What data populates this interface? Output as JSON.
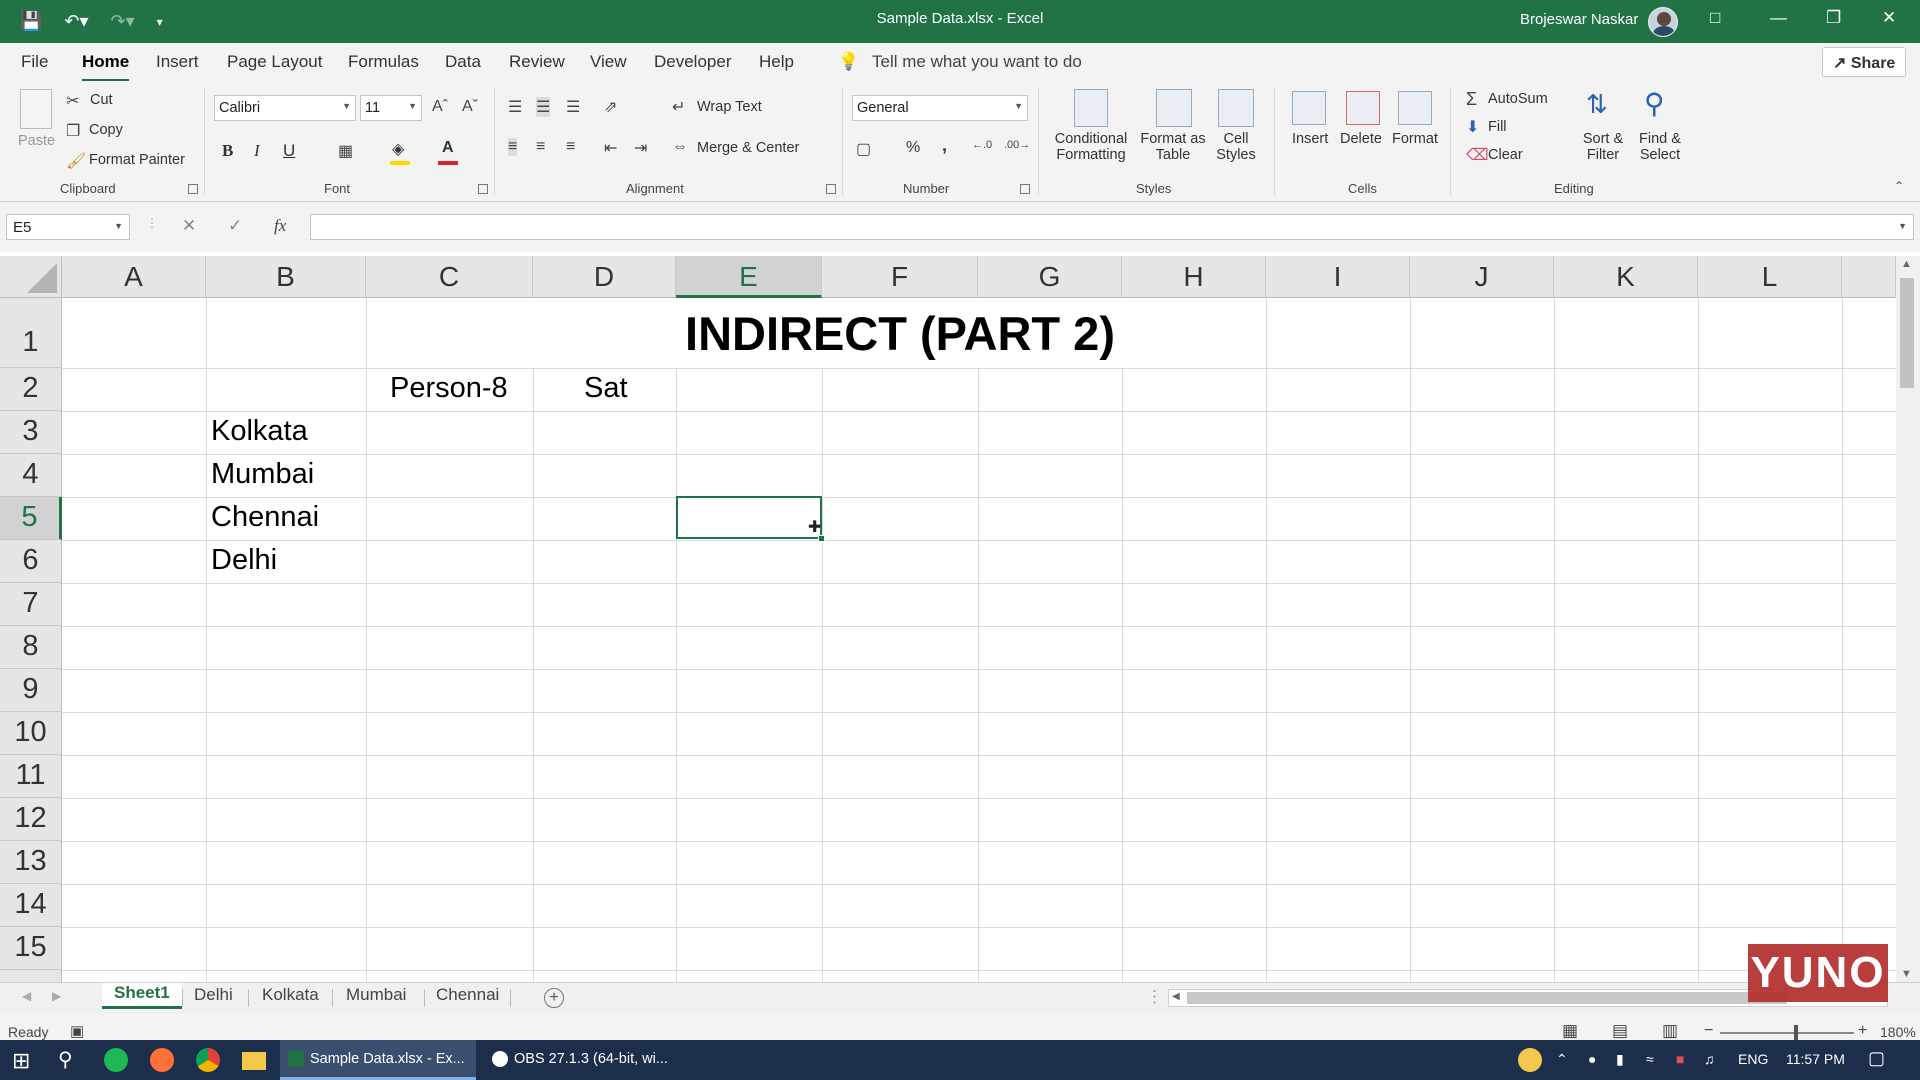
{
  "window": {
    "title": "Sample Data.xlsx  -  Excel",
    "user": "Brojeswar Naskar"
  },
  "menu": {
    "tabs": [
      "File",
      "Home",
      "Insert",
      "Page Layout",
      "Formulas",
      "Data",
      "Review",
      "View",
      "Developer",
      "Help"
    ],
    "active": "Home",
    "tell_me": "Tell me what you want to do",
    "share": "Share"
  },
  "ribbon": {
    "clipboard": {
      "label": "Clipboard",
      "paste": "Paste",
      "cut": "Cut",
      "copy": "Copy",
      "format_painter": "Format Painter"
    },
    "font": {
      "label": "Font",
      "name": "Calibri",
      "size": "11",
      "bold": "B",
      "italic": "I",
      "underline": "U"
    },
    "alignment": {
      "label": "Alignment",
      "wrap_text": "Wrap Text",
      "merge_center": "Merge & Center"
    },
    "number": {
      "label": "Number",
      "format": "General",
      "percent": "%",
      "comma": ","
    },
    "styles": {
      "label": "Styles",
      "conditional": "Conditional Formatting",
      "conditional_l1": "Conditional",
      "conditional_l2": "Formatting",
      "format_table_l1": "Format as",
      "format_table_l2": "Table",
      "cell_styles_l1": "Cell",
      "cell_styles_l2": "Styles"
    },
    "cells": {
      "label": "Cells",
      "insert": "Insert",
      "delete": "Delete",
      "format": "Format"
    },
    "editing": {
      "label": "Editing",
      "autosum": "AutoSum",
      "fill": "Fill",
      "clear": "Clear",
      "sort_l1": "Sort &",
      "sort_l2": "Filter",
      "find_l1": "Find &",
      "find_l2": "Select"
    }
  },
  "formula_bar": {
    "name_box": "E5",
    "fx": "fx",
    "formula": ""
  },
  "sheet": {
    "columns": [
      "A",
      "B",
      "C",
      "D",
      "E",
      "F",
      "G",
      "H",
      "I",
      "J",
      "K",
      "L"
    ],
    "rows": [
      "1",
      "2",
      "3",
      "4",
      "5",
      "6",
      "7",
      "8",
      "9",
      "10",
      "11",
      "12",
      "13",
      "14",
      "15"
    ],
    "selected_cell": "E5",
    "title": "INDIRECT (PART 2)",
    "c2": "Person-8",
    "d2": "Sat",
    "b3": "Kolkata",
    "b4": "Mumbai",
    "b5": "Chennai",
    "b6": "Delhi"
  },
  "sheet_tabs": [
    "Sheet1",
    "Delhi",
    "Kolkata",
    "Mumbai",
    "Chennai"
  ],
  "active_sheet": "Sheet1",
  "status": {
    "ready": "Ready",
    "zoom": "180%"
  },
  "watermark": "YUNO",
  "taskbar": {
    "tasks": [
      "Sample Data.xlsx - Ex...",
      "OBS 27.1.3 (64-bit, wi..."
    ],
    "language": "ENG",
    "time": "11:57 PM"
  },
  "colors": {
    "excel_green": "#217346",
    "taskbar": "#1c2e4a"
  }
}
